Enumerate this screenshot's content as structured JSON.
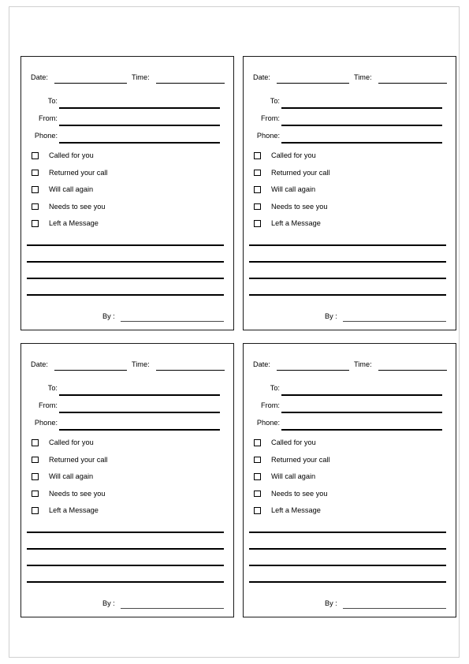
{
  "page": {
    "document_type": "phone-message-form",
    "border_color": "#d0d0d0",
    "ink_color": "#000000",
    "background_color": "#ffffff",
    "cards_across": 2,
    "cards_down": 2,
    "card_count": 4
  },
  "card": {
    "date_label": "Date:",
    "time_label": "Time:",
    "to_label": "To:",
    "from_label": "From:",
    "phone_label": "Phone:",
    "by_label": "By :",
    "checkbox_items": [
      "Called for you",
      "Returned your call",
      "Will call again",
      "Needs to see you",
      "Left a Message"
    ],
    "message_line_count": 4,
    "date_value": "",
    "time_value": "",
    "to_value": "",
    "from_value": "",
    "phone_value": "",
    "by_value": ""
  },
  "cards": [
    {
      "index": "1",
      "position": "top-left"
    },
    {
      "index": "2",
      "position": "top-right"
    },
    {
      "index": "3",
      "position": "bottom-left"
    },
    {
      "index": "4",
      "position": "bottom-right"
    }
  ]
}
